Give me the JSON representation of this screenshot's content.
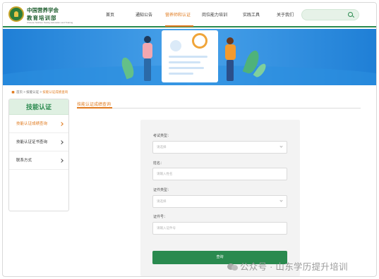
{
  "header": {
    "org_name_line1": "中国营养学会",
    "org_name_line2": "教育培训部",
    "org_sub": "Chinese Nutrition Society Education and Training",
    "nav": [
      {
        "label": "首页",
        "active": false
      },
      {
        "label": "通知公告",
        "active": false
      },
      {
        "label": "营养师和认证",
        "active": true
      },
      {
        "label": "岗位能力培训",
        "active": false
      },
      {
        "label": "实践工具",
        "active": false
      },
      {
        "label": "关于我们",
        "active": false
      }
    ],
    "search_placeholder": ""
  },
  "breadcrumb": {
    "items": [
      "首页",
      "技能认证"
    ],
    "current": "技能认证成绩查询"
  },
  "sidebar": {
    "title": "技能认证",
    "items": [
      {
        "label": "技能认证成绩查询",
        "active": true
      },
      {
        "label": "技能认证证书查询",
        "active": false
      },
      {
        "label": "联系方式",
        "active": false
      }
    ]
  },
  "main": {
    "section_title": "技能认证成绩查询",
    "form": {
      "fields": [
        {
          "label": "考试类型：",
          "placeholder": "请选择",
          "type": "select"
        },
        {
          "label": "姓名：",
          "placeholder": "请输入姓名",
          "type": "input"
        },
        {
          "label": "证件类型：",
          "placeholder": "请选择",
          "type": "select"
        },
        {
          "label": "证件号：",
          "placeholder": "请输入证件号",
          "type": "input"
        }
      ],
      "submit_label": "查询"
    }
  },
  "watermark": {
    "text": "公众号 · 山东学历提升培训"
  },
  "colors": {
    "brand_green": "#2a8a4f",
    "accent_orange": "#e07a1e",
    "banner_blue": "#2b8fe0"
  }
}
